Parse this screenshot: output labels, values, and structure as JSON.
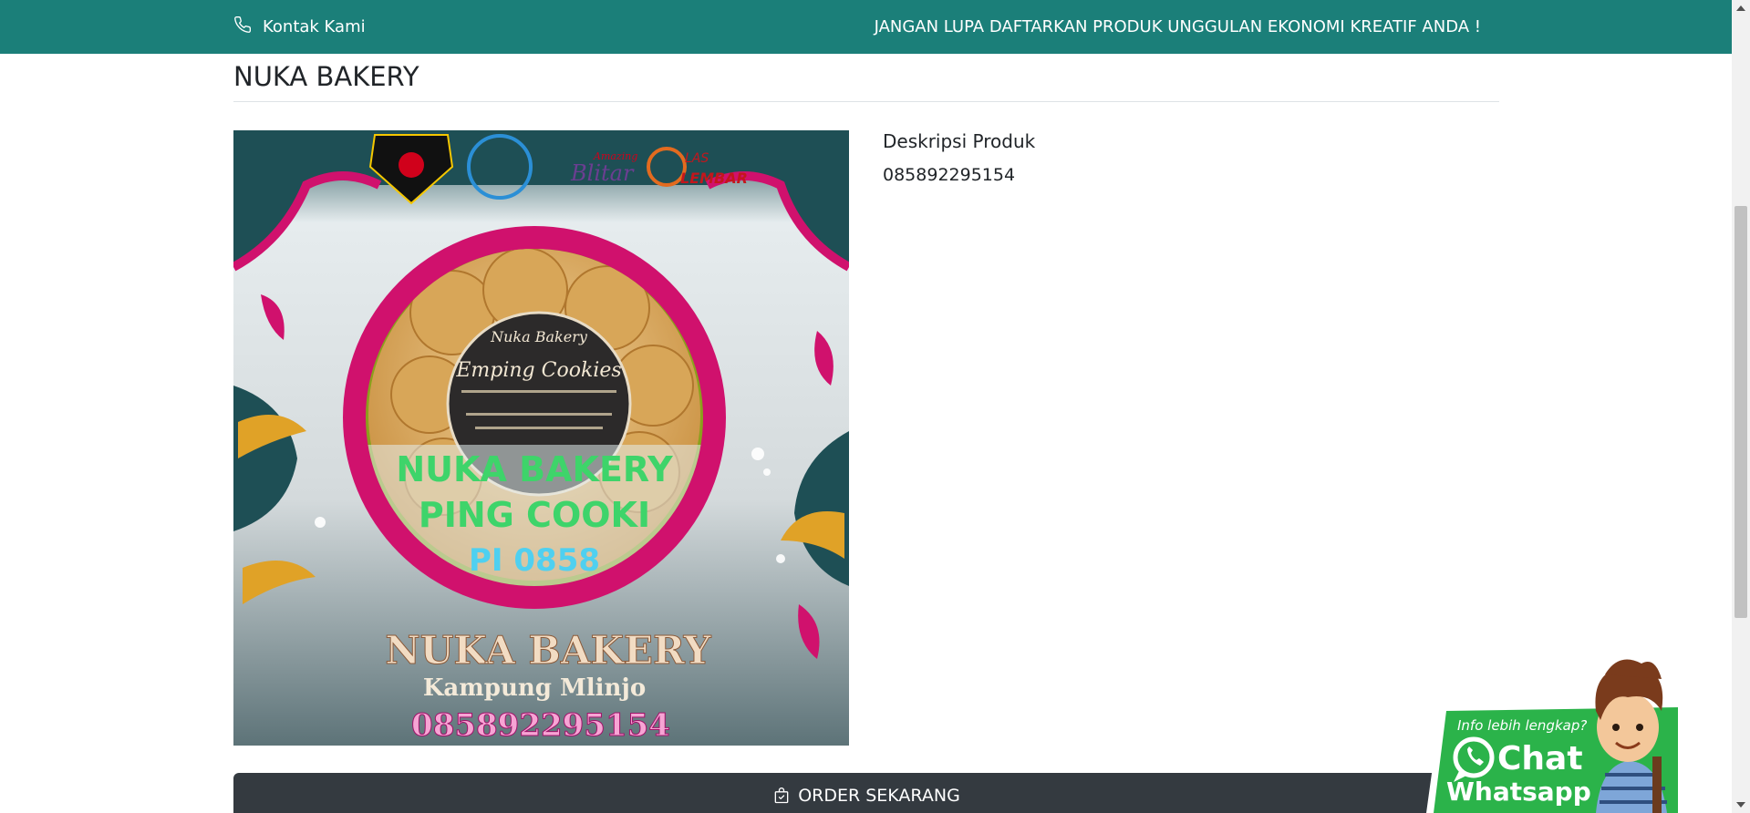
{
  "topbar": {
    "contact_label": "Kontak Kami",
    "contact_icon": "phone-icon",
    "promo_text": "JANGAN LUPA DAFTARKAN PRODUK UNGGULAN EKONOMI KREATIF ANDA !",
    "background_color": "#1b7f79"
  },
  "product": {
    "title": "NUKA BAKERY",
    "image": {
      "badge_text": "Nuka Bakery",
      "label_text": "Emping Cookies",
      "overlay_line1": "NUKA BAKERY",
      "overlay_line2": "PING COOKI",
      "overlay_line3": "PI 0858",
      "name": "NUKA BAKERY",
      "location": "Kampung Mlinjo",
      "phone": "085892295154",
      "logo_blitar": "Blitar",
      "logo_amazing": "Amazing",
      "logo_las": "LAS",
      "logo_lembar": "LEMBAR"
    },
    "description_heading": "Deskripsi Produk",
    "description_text": "085892295154"
  },
  "order": {
    "label": "ORDER SEKARANG",
    "icon": "shopping-bag-icon",
    "background_color": "#343a40"
  },
  "chat_widget": {
    "info_text": "Info lebih lengkap?",
    "chat_label": "Chat",
    "whatsapp_label": "Whatsapp",
    "icon": "whatsapp-icon",
    "color": "#2bb34a"
  }
}
